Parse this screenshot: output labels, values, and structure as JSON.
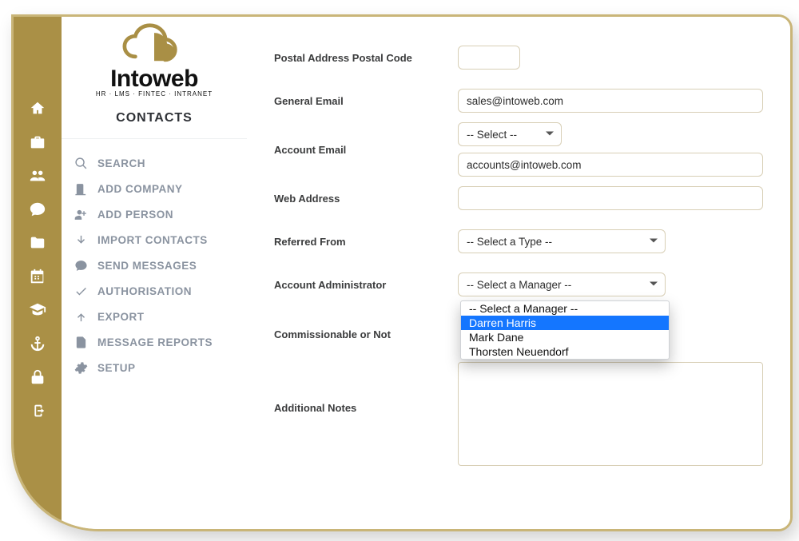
{
  "logo": {
    "wordmark": "Intoweb",
    "tagline": "HR · LMS · FINTEC · INTRANET"
  },
  "module": "CONTACTS",
  "rail_icons": [
    {
      "name": "home-icon"
    },
    {
      "name": "briefcase-icon"
    },
    {
      "name": "users-icon"
    },
    {
      "name": "chat-icon"
    },
    {
      "name": "folder-icon"
    },
    {
      "name": "calendar-icon"
    },
    {
      "name": "graduation-icon"
    },
    {
      "name": "anchor-icon"
    },
    {
      "name": "lock-icon"
    },
    {
      "name": "logout-icon"
    }
  ],
  "menu": [
    {
      "icon": "search-icon",
      "label": "SEARCH"
    },
    {
      "icon": "building-icon",
      "label": "ADD COMPANY"
    },
    {
      "icon": "person-plus-icon",
      "label": "ADD PERSON"
    },
    {
      "icon": "arrow-down-icon",
      "label": "IMPORT CONTACTS"
    },
    {
      "icon": "speech-icon",
      "label": "SEND MESSAGES"
    },
    {
      "icon": "check-icon",
      "label": "AUTHORISATION"
    },
    {
      "icon": "arrow-up-icon",
      "label": "EXPORT"
    },
    {
      "icon": "report-icon",
      "label": "MESSAGE REPORTS"
    },
    {
      "icon": "gear-icon",
      "label": "SETUP"
    }
  ],
  "form": {
    "postal_code": {
      "label": "Postal Address Postal Code",
      "value": ""
    },
    "general_email": {
      "label": "General Email",
      "value": "sales@intoweb.com"
    },
    "account_email": {
      "label": "Account Email",
      "select": "-- Select --",
      "value": "accounts@intoweb.com"
    },
    "web_address": {
      "label": "Web Address",
      "value": ""
    },
    "referred_from": {
      "label": "Referred From",
      "select": "-- Select a Type --"
    },
    "account_admin": {
      "label": "Account Administrator",
      "select": "-- Select a Manager --",
      "options": [
        {
          "text": "-- Select a Manager --",
          "selected": false
        },
        {
          "text": "Darren Harris",
          "selected": true
        },
        {
          "text": "Mark Dane",
          "selected": false
        },
        {
          "text": "Thorsten Neuendorf",
          "selected": false
        }
      ]
    },
    "commissionable": {
      "label": "Commissionable or Not"
    },
    "notes": {
      "label": "Additional Notes",
      "value": ""
    }
  }
}
